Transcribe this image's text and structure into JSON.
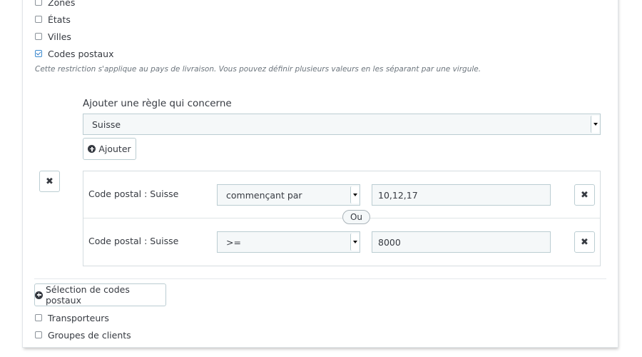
{
  "restrictions": {
    "zones_label": "Zones",
    "etats_label": "États",
    "villes_label": "Villes",
    "codes_postaux_label": "Codes postaux",
    "transporteurs_label": "Transporteurs",
    "groupes_label": "Groupes de clients",
    "help_text": "Cette restriction s'applique au pays de livraison. Vous pouvez définir plusieurs valeurs en les séparant par une virgule."
  },
  "rule_builder": {
    "label": "Ajouter une règle qui concerne",
    "country_selected": "Suisse",
    "add_button": "Ajouter"
  },
  "rules": [
    {
      "label": "Code postal : Suisse",
      "operator": "commençant par",
      "value": "10,12,17"
    },
    {
      "label": "Code postal : Suisse",
      "operator": ">=",
      "value": "8000"
    }
  ],
  "or_label": "Ou",
  "selection_button": "Sélection de codes postaux",
  "icons": {
    "add": "plus-circle-icon",
    "remove": "close-icon"
  },
  "colors": {
    "checkbox_accent": "#2b77c6",
    "input_bg": "#f5f8f9",
    "border": "#bbcdd2"
  }
}
